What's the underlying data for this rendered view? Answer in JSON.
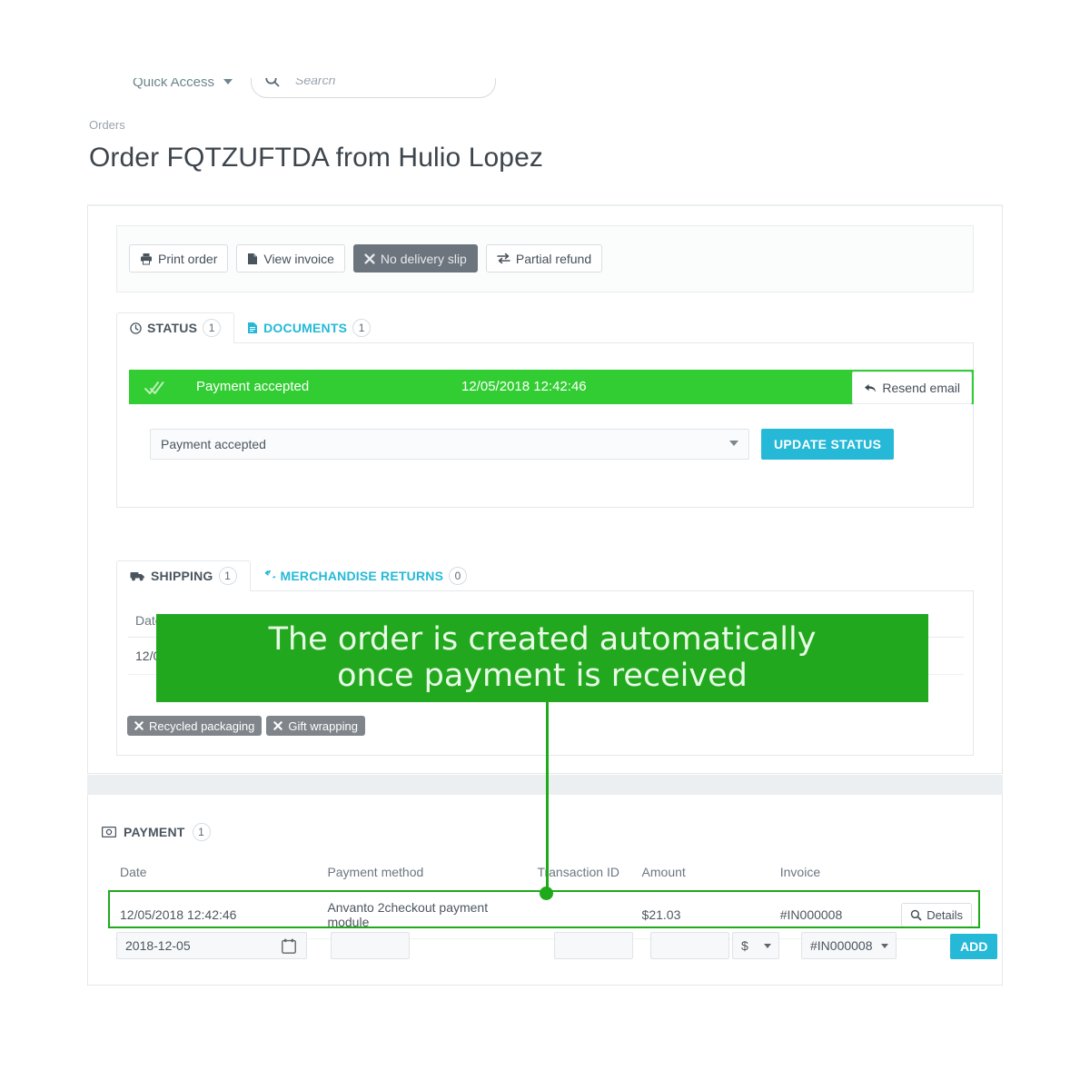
{
  "topbar": {
    "quick_access_label": "Quick Access",
    "search_placeholder": "Search",
    "search_icon": "search-icon",
    "caret_icon": "chevron-down-icon"
  },
  "breadcrumb": "Orders",
  "page_title": "Order FQTZUFTDA from Hulio Lopez",
  "toolbar": {
    "buttons": [
      {
        "label": "Print order",
        "icon": "printer-icon",
        "disabled": false
      },
      {
        "label": "View invoice",
        "icon": "document-icon",
        "disabled": false
      },
      {
        "label": "No delivery slip",
        "icon": "times-icon",
        "disabled": true
      },
      {
        "label": "Partial refund",
        "icon": "exchange-arrows-icon",
        "disabled": false
      }
    ]
  },
  "status_section": {
    "tabs": [
      {
        "label": "STATUS",
        "count": "1",
        "icon": "clock-icon",
        "active": true
      },
      {
        "label": "DOCUMENTS",
        "count": "1",
        "icon": "file-text-icon",
        "active": false
      }
    ],
    "current_status": {
      "label": "Payment accepted",
      "date": "12/05/2018 12:42:46",
      "resend_label": "Resend email",
      "resend_icon": "reply-arrow-icon",
      "check_icon": "double-check-icon",
      "bar_color": "#32cd32"
    },
    "status_select_value": "Payment accepted",
    "update_button_label": "UPDATE STATUS"
  },
  "shipping_section": {
    "tabs": [
      {
        "label": "SHIPPING",
        "count": "1",
        "icon": "truck-icon",
        "active": true
      },
      {
        "label": "MERCHANDISE RETURNS",
        "count": "0",
        "icon": "return-arrow-icon",
        "active": false
      }
    ],
    "table": {
      "headers": [
        "Date"
      ],
      "rows": [
        [
          "12/0"
        ]
      ]
    },
    "chips": [
      {
        "label": "Recycled packaging",
        "icon": "times-icon"
      },
      {
        "label": "Gift wrapping",
        "icon": "times-icon"
      }
    ]
  },
  "payment_section": {
    "title": "PAYMENT",
    "count": "1",
    "icon": "money-bill-icon",
    "headers": [
      "Date",
      "Payment method",
      "Transaction ID",
      "Amount",
      "Invoice"
    ],
    "rows": [
      {
        "date": "12/05/2018 12:42:46",
        "method": "Anvanto 2checkout payment module",
        "transaction_id": "",
        "amount": "$21.03",
        "invoice": "#IN000008",
        "details_label": "Details",
        "details_icon": "magnifier-icon"
      }
    ],
    "new_row": {
      "date_value": "2018-12-05",
      "calendar_icon": "calendar-icon",
      "method_value": "",
      "transaction_value": "",
      "amount_value": "",
      "currency_value": "$",
      "invoice_value": "#IN000008",
      "add_label": "ADD"
    }
  },
  "annotation": {
    "line1": "The order is created automatically",
    "line2": "once payment is received",
    "color": "#22a81e"
  }
}
